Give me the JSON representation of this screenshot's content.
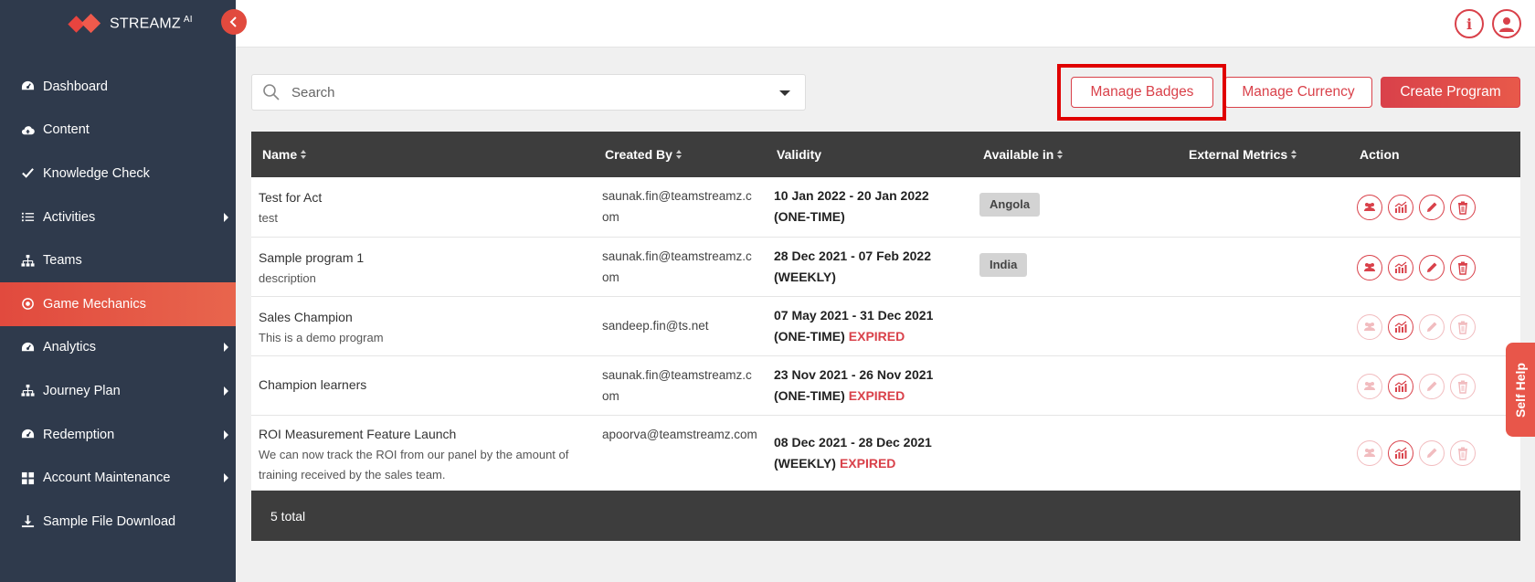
{
  "brand": {
    "name": "STREAMZ",
    "sup": "AI"
  },
  "sidebar": {
    "items": [
      {
        "label": "Dashboard",
        "icon": "gauge-icon"
      },
      {
        "label": "Content",
        "icon": "cloud-upload-icon"
      },
      {
        "label": "Knowledge Check",
        "icon": "check-icon"
      },
      {
        "label": "Activities",
        "icon": "list-icon",
        "submenu": true
      },
      {
        "label": "Teams",
        "icon": "hierarchy-icon"
      },
      {
        "label": "Game Mechanics",
        "icon": "target-icon",
        "active": true
      },
      {
        "label": "Analytics",
        "icon": "gauge-icon",
        "submenu": true
      },
      {
        "label": "Journey Plan",
        "icon": "hierarchy-icon",
        "submenu": true
      },
      {
        "label": "Redemption",
        "icon": "gauge-icon",
        "submenu": true
      },
      {
        "label": "Account Maintenance",
        "icon": "grid-icon",
        "submenu": true
      },
      {
        "label": "Sample File Download",
        "icon": "download-icon"
      }
    ]
  },
  "topbar": {
    "info_icon": "i"
  },
  "search": {
    "placeholder": "Search"
  },
  "toolbar": {
    "manage_badges": "Manage Badges",
    "manage_currency": "Manage Currency",
    "create_program": "Create Program"
  },
  "table": {
    "headers": {
      "name": "Name",
      "created_by": "Created By",
      "validity": "Validity",
      "available_in": "Available in",
      "external_metrics": "External Metrics",
      "action": "Action"
    },
    "rows": [
      {
        "name": "Test for Act",
        "desc": "test",
        "created_by": "saunak.fin@teamstreamz.com",
        "validity": "10 Jan 2022 - 20 Jan 2022",
        "frequency": "(ONE-TIME)",
        "expired": "",
        "available_in": "Angola"
      },
      {
        "name": "Sample program 1",
        "desc": "description",
        "created_by": "saunak.fin@teamstreamz.com",
        "validity": "28 Dec 2021 - 07 Feb 2022",
        "frequency": "(WEEKLY)",
        "expired": "",
        "available_in": "India"
      },
      {
        "name": "Sales Champion",
        "desc": "This is a demo program",
        "created_by": "sandeep.fin@ts.net",
        "validity": "07 May 2021 - 31 Dec 2021",
        "frequency": "(ONE-TIME)",
        "expired": "EXPIRED",
        "available_in": ""
      },
      {
        "name": "Champion learners",
        "desc": "",
        "created_by": "saunak.fin@teamstreamz.com",
        "validity": "23 Nov 2021 - 26 Nov 2021",
        "frequency": "(ONE-TIME)",
        "expired": "EXPIRED",
        "available_in": ""
      },
      {
        "name": "ROI Measurement Feature Launch",
        "desc": "We can now track the ROI from our panel by the amount of training received by the sales team.",
        "created_by": "apoorva@teamstreamz.com",
        "validity": "08 Dec 2021 - 28 Dec 2021",
        "frequency": "(WEEKLY)",
        "expired": "EXPIRED",
        "available_in": ""
      }
    ],
    "footer": "5 total"
  },
  "self_help": "Self Help",
  "colors": {
    "sidebar": "#2f3a4c",
    "accent": "#d9414a",
    "header": "#3d3d3d"
  }
}
